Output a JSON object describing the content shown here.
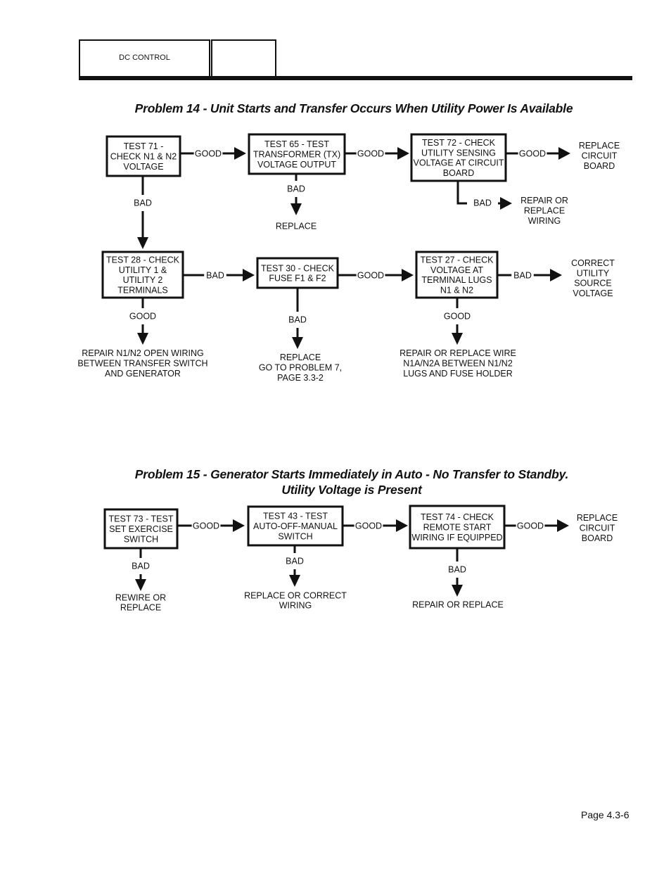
{
  "header": {
    "section_label": "DC CONTROL",
    "second_tab_label": ""
  },
  "problem14": {
    "title": "Problem 14 - Unit Starts and Transfer Occurs When Utility Power Is Available",
    "nodes": {
      "test71": [
        "TEST 71 -",
        "CHECK N1 & N2",
        "VOLTAGE"
      ],
      "test65": [
        "TEST 65 - TEST",
        "TRANSFORMER (TX)",
        "VOLTAGE OUTPUT"
      ],
      "test72": [
        "TEST 72 - CHECK",
        "UTILITY SENSING",
        "VOLTAGE AT CIRCUIT",
        "BOARD"
      ],
      "replace_circuit_board": [
        "REPLACE",
        "CIRCUIT",
        "BOARD"
      ],
      "replace": [
        "REPLACE"
      ],
      "repair_replace_wiring": [
        "REPAIR OR",
        "REPLACE",
        "WIRING"
      ],
      "test28": [
        "TEST 28 - CHECK",
        "UTILITY 1 &",
        "UTILITY 2",
        "TERMINALS"
      ],
      "test30": [
        "TEST 30 - CHECK",
        "FUSE F1 & F2"
      ],
      "test27": [
        "TEST 27 - CHECK",
        "VOLTAGE AT",
        "TERMINAL LUGS",
        "N1 & N2"
      ],
      "correct_utility": [
        "CORRECT",
        "UTILITY",
        "SOURCE",
        "VOLTAGE"
      ],
      "repair_n1n2": [
        "REPAIR N1/N2 OPEN WIRING",
        "BETWEEN TRANSFER SWITCH",
        "AND GENERATOR"
      ],
      "replace_goto": [
        "REPLACE",
        "GO TO PROBLEM 7,",
        "PAGE 3.3-2"
      ],
      "repair_wire_n1a": [
        "REPAIR OR REPLACE WIRE",
        "N1A/N2A BETWEEN N1/N2",
        "LUGS AND FUSE HOLDER"
      ]
    },
    "edges": [
      {
        "from": "test71",
        "to": "test65",
        "label": "GOOD"
      },
      {
        "from": "test65",
        "to": "test72",
        "label": "GOOD"
      },
      {
        "from": "test72",
        "to": "replace_circuit_board",
        "label": "GOOD"
      },
      {
        "from": "test65",
        "to": "replace",
        "label": "BAD"
      },
      {
        "from": "test72",
        "to": "repair_replace_wiring",
        "label": "BAD"
      },
      {
        "from": "test71",
        "to": "test28",
        "label": "BAD"
      },
      {
        "from": "test28",
        "to": "test30",
        "label": "BAD"
      },
      {
        "from": "test30",
        "to": "test27",
        "label": "GOOD"
      },
      {
        "from": "test27",
        "to": "correct_utility",
        "label": "BAD"
      },
      {
        "from": "test28",
        "to": "repair_n1n2",
        "label": "GOOD"
      },
      {
        "from": "test30",
        "to": "replace_goto",
        "label": "BAD"
      },
      {
        "from": "test27",
        "to": "repair_wire_n1a",
        "label": "GOOD"
      }
    ]
  },
  "problem15": {
    "title_line1": "Problem 15 - Generator Starts Immediately in Auto - No Transfer to Standby.",
    "title_line2": "Utility Voltage is Present",
    "nodes": {
      "test73": [
        "TEST 73 - TEST",
        "SET EXERCISE",
        "SWITCH"
      ],
      "test43": [
        "TEST 43 - TEST",
        "AUTO-OFF-MANUAL",
        "SWITCH"
      ],
      "test74": [
        "TEST 74 - CHECK",
        "REMOTE START",
        "WIRING IF EQUIPPED"
      ],
      "replace_circuit_board": [
        "REPLACE",
        "CIRCUIT",
        "BOARD"
      ],
      "rewire_replace": [
        "REWIRE OR",
        "REPLACE"
      ],
      "replace_correct_wiring": [
        "REPLACE OR CORRECT",
        "WIRING"
      ],
      "repair_replace": [
        "REPAIR OR REPLACE"
      ]
    },
    "edges": [
      {
        "from": "test73",
        "to": "test43",
        "label": "GOOD"
      },
      {
        "from": "test43",
        "to": "test74",
        "label": "GOOD"
      },
      {
        "from": "test74",
        "to": "replace_circuit_board",
        "label": "GOOD"
      },
      {
        "from": "test73",
        "to": "rewire_replace",
        "label": "BAD"
      },
      {
        "from": "test43",
        "to": "replace_correct_wiring",
        "label": "BAD"
      },
      {
        "from": "test74",
        "to": "repair_replace",
        "label": "BAD"
      }
    ]
  },
  "footer": {
    "page_number": "Page 4.3-6"
  }
}
